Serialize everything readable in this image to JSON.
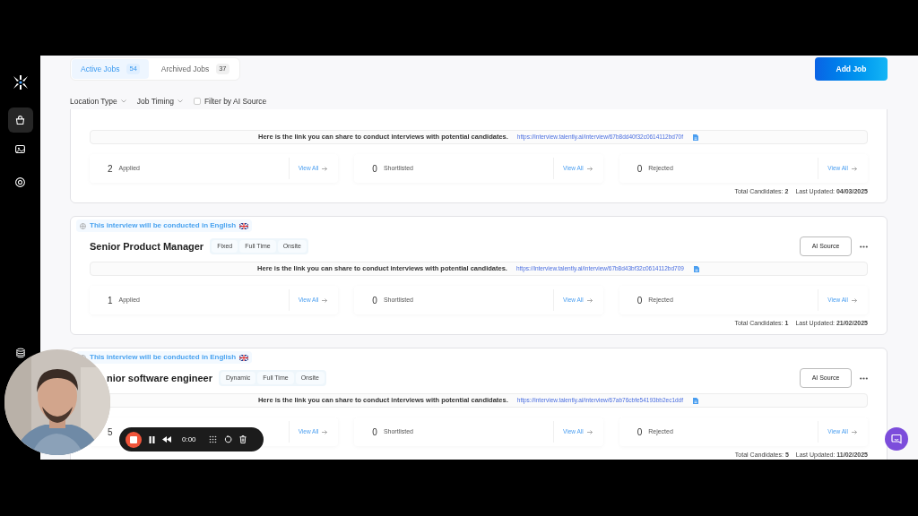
{
  "sidebar": {
    "items": [
      {
        "selected": true
      },
      {
        "selected": false
      },
      {
        "selected": false
      }
    ],
    "bottom_items": [
      {
        "selected": false
      }
    ]
  },
  "tabs": [
    {
      "label": "Active Jobs",
      "count": "54",
      "selected": true
    },
    {
      "label": "Archived Jobs",
      "count": "37",
      "selected": false
    }
  ],
  "add_job_button": "Add Job",
  "filters": [
    {
      "kind": "dropdown",
      "label": "Location Type"
    },
    {
      "kind": "dropdown",
      "label": "Job Timing"
    },
    {
      "kind": "checkbox",
      "label": "Filter by AI Source",
      "checked": false
    }
  ],
  "jobs": [
    {
      "share_text": "Here is the link you can share to conduct interviews with potential candidates.",
      "link": "https://interview.talently.ai/interview/67b8dd40f32c0614112bd70f",
      "stats": [
        {
          "count": "2",
          "label": "Applied",
          "link": "View All"
        },
        {
          "count": "0",
          "label": "Shortlisted",
          "link": "View All"
        },
        {
          "count": "0",
          "label": "Rejected",
          "link": "View All"
        }
      ],
      "total": "Total Candidates: **2**",
      "updated": "Last Updated: **04/03/2025**"
    },
    {
      "language": "This interview will be conducted in English",
      "title": "Senior Product Manager",
      "tags": [
        "Fixed",
        "Full Time",
        "Onsite"
      ],
      "ai_source_button": "AI Source",
      "share_text": "Here is the link you can share to conduct interviews with potential candidates.",
      "link": "https://interview.talently.ai/interview/67b8d43bf32c0614112bd709",
      "stats": [
        {
          "count": "1",
          "label": "Applied",
          "link": "View All"
        },
        {
          "count": "0",
          "label": "Shortlisted",
          "link": "View All"
        },
        {
          "count": "0",
          "label": "Rejected",
          "link": "View All"
        }
      ],
      "total": "Total Candidates: **1**",
      "updated": "Last Updated: **21/02/2025**"
    },
    {
      "language": "This interview will be conducted in English",
      "title": "nior software engineer",
      "tags": [
        "Dynamic",
        "Full Time",
        "Onsite"
      ],
      "ai_source_button": "AI Source",
      "share_text": "Here is the link you can share to conduct interviews with potential candidates.",
      "link": "https://interview.talently.ai/interview/67ab76cbfe54193bb2ec1ddf",
      "stats": [
        {
          "count": "5",
          "link": "View All"
        },
        {
          "count": "0",
          "label": "Shortlisted",
          "link": "View All"
        },
        {
          "count": "0",
          "label": "Rejected",
          "link": "View All"
        }
      ],
      "total": "Total Candidates: **5**",
      "updated": "Last Updated: **11/02/2025**"
    }
  ],
  "recorder": {
    "time": "0:00"
  }
}
